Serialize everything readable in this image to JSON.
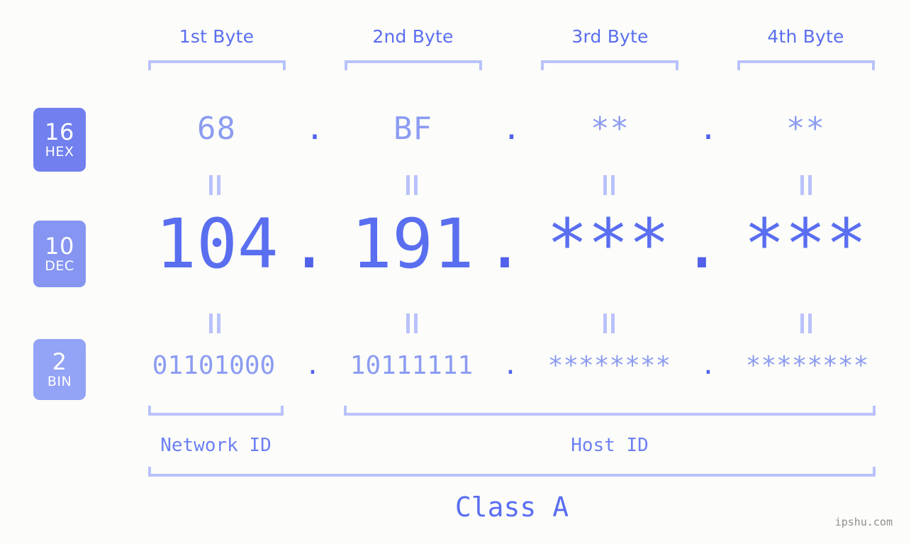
{
  "meta": {
    "background": "#fcfdfa",
    "accent": "#5a6ef0",
    "accent_light": "#8c9cf2",
    "bracket": "#b9c2fb",
    "badge_dark": "#7180ee",
    "badge_mid": "#8190f0",
    "badge_light": "#93a3f5"
  },
  "headers": {
    "byte1": "1st Byte",
    "byte2": "2nd Byte",
    "byte3": "3rd Byte",
    "byte4": "4th Byte"
  },
  "badges": {
    "hex": {
      "num": "16",
      "unit": "HEX",
      "color": "#7180ee"
    },
    "dec": {
      "num": "10",
      "unit": "DEC",
      "color": "#8695f1"
    },
    "bin": {
      "num": "2",
      "unit": "BIN",
      "color": "#93a3f5"
    }
  },
  "rows": {
    "hex": {
      "name": "hexadecimal",
      "octets": [
        "68",
        "BF",
        "**",
        "**"
      ],
      "separator": "."
    },
    "dec": {
      "name": "decimal",
      "octets": [
        "104",
        "191",
        "***",
        "***"
      ],
      "separator": "."
    },
    "bin": {
      "name": "binary",
      "octets": [
        "01101000",
        "10111111",
        "********",
        "********"
      ],
      "separator": "."
    }
  },
  "connector": "‖",
  "sections": {
    "network_id": "Network ID",
    "host_id": "Host ID",
    "class": "Class A"
  },
  "watermark": "ipshu.com"
}
